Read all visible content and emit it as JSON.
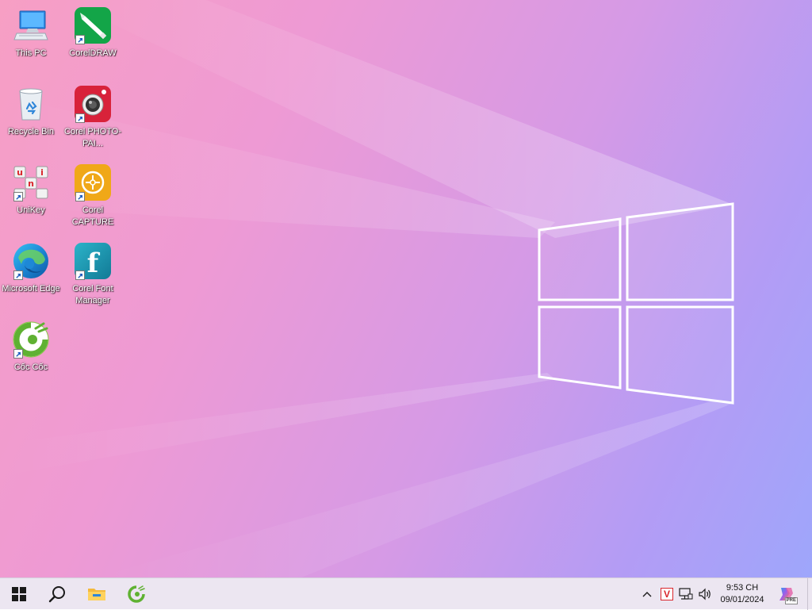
{
  "desktop": {
    "icons": [
      {
        "id": "this-pc",
        "label": "This PC",
        "icon": "computer-icon"
      },
      {
        "id": "coreldraw",
        "label": "CorelDRAW",
        "icon": "coreldraw-icon"
      },
      {
        "id": "recycle-bin",
        "label": "Recycle Bin",
        "icon": "recycle-bin-icon"
      },
      {
        "id": "corel-photo-paint",
        "label": "Corel PHOTO-PAI...",
        "icon": "photo-paint-icon"
      },
      {
        "id": "unikey",
        "label": "UniKey",
        "icon": "unikey-icon"
      },
      {
        "id": "corel-capture",
        "label": "Corel CAPTURE",
        "icon": "capture-icon"
      },
      {
        "id": "microsoft-edge",
        "label": "Microsoft Edge",
        "icon": "edge-icon"
      },
      {
        "id": "corel-font-manager",
        "label": "Corel Font Manager",
        "icon": "font-manager-icon"
      },
      {
        "id": "coc-coc",
        "label": "Cốc Cốc",
        "icon": "coccoc-icon"
      }
    ],
    "colors": {
      "wallpaper_start": "#f79fc4",
      "wallpaper_mid": "#d59ae6",
      "wallpaper_end": "#9ea6fb",
      "logo_stroke": "#ffffff"
    }
  },
  "taskbar": {
    "buttons": [
      {
        "id": "start",
        "icon": "windows-start-icon"
      },
      {
        "id": "search",
        "icon": "search-icon"
      },
      {
        "id": "file-explorer",
        "icon": "folder-icon"
      },
      {
        "id": "coccoc-pinned",
        "icon": "coccoc-icon"
      }
    ],
    "tray": {
      "chevron": "chevron-up-icon",
      "unikey_indicator": "V",
      "network": "network-icon",
      "volume": "volume-icon",
      "copilot": "copilot-icon",
      "copilot_badge": "PRE"
    },
    "clock": {
      "time": "9:53 CH",
      "date": "09/01/2024"
    },
    "colors": {
      "background": "#ece6f1",
      "unikey_red": "#d9262c"
    }
  }
}
